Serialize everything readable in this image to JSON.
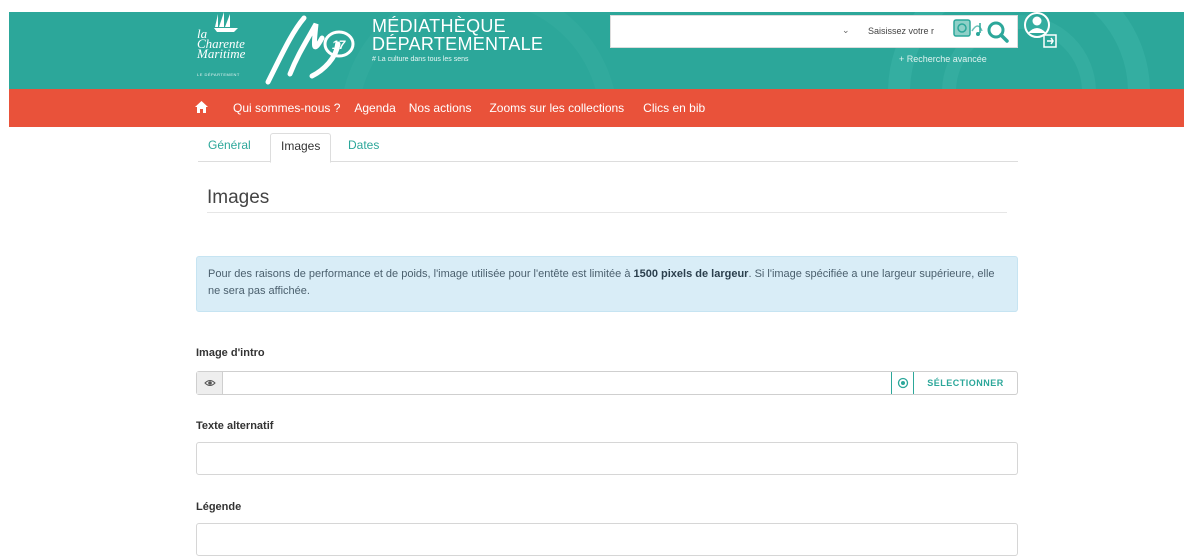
{
  "header": {
    "logo_cm_line1": "la",
    "logo_cm_line2": "Charente",
    "logo_cm_line3": "Maritime",
    "logo_cm_sub": "LE DÉPARTEMENT",
    "title_line1": "MÉDIATHÈQUE",
    "title_line2": "DÉPARTEMENTALE",
    "tagline": "# La culture dans tous les sens",
    "search_placeholder": "Saisissez votre r",
    "advanced_search": "+ Recherche avancée"
  },
  "nav": {
    "items": [
      {
        "label": "Qui sommes-nous ?"
      },
      {
        "label": "Agenda"
      },
      {
        "label": "Nos actions"
      },
      {
        "label": "Zooms sur les collections"
      },
      {
        "label": "Clics en bib"
      }
    ]
  },
  "tabs": [
    {
      "label": "Général"
    },
    {
      "label": "Images"
    },
    {
      "label": "Dates"
    }
  ],
  "main": {
    "section_title": "Images",
    "info_pre": "Pour des raisons de performance et de poids, l'image utilisée pour l'entête est limitée à ",
    "info_bold": "1500 pixels de largeur",
    "info_post": ". Si l'image spécifiée a une largeur supérieure, elle ne sera pas affichée.",
    "intro_image_label": "Image d'intro",
    "intro_image_value": "",
    "select_button": "SÉLECTIONNER",
    "alt_text_label": "Texte alternatif",
    "alt_text_value": "",
    "caption_label": "Légende",
    "caption_value": ""
  },
  "colors": {
    "teal": "#2ca79a",
    "red": "#e9523a",
    "info_bg": "#d9edf7"
  }
}
